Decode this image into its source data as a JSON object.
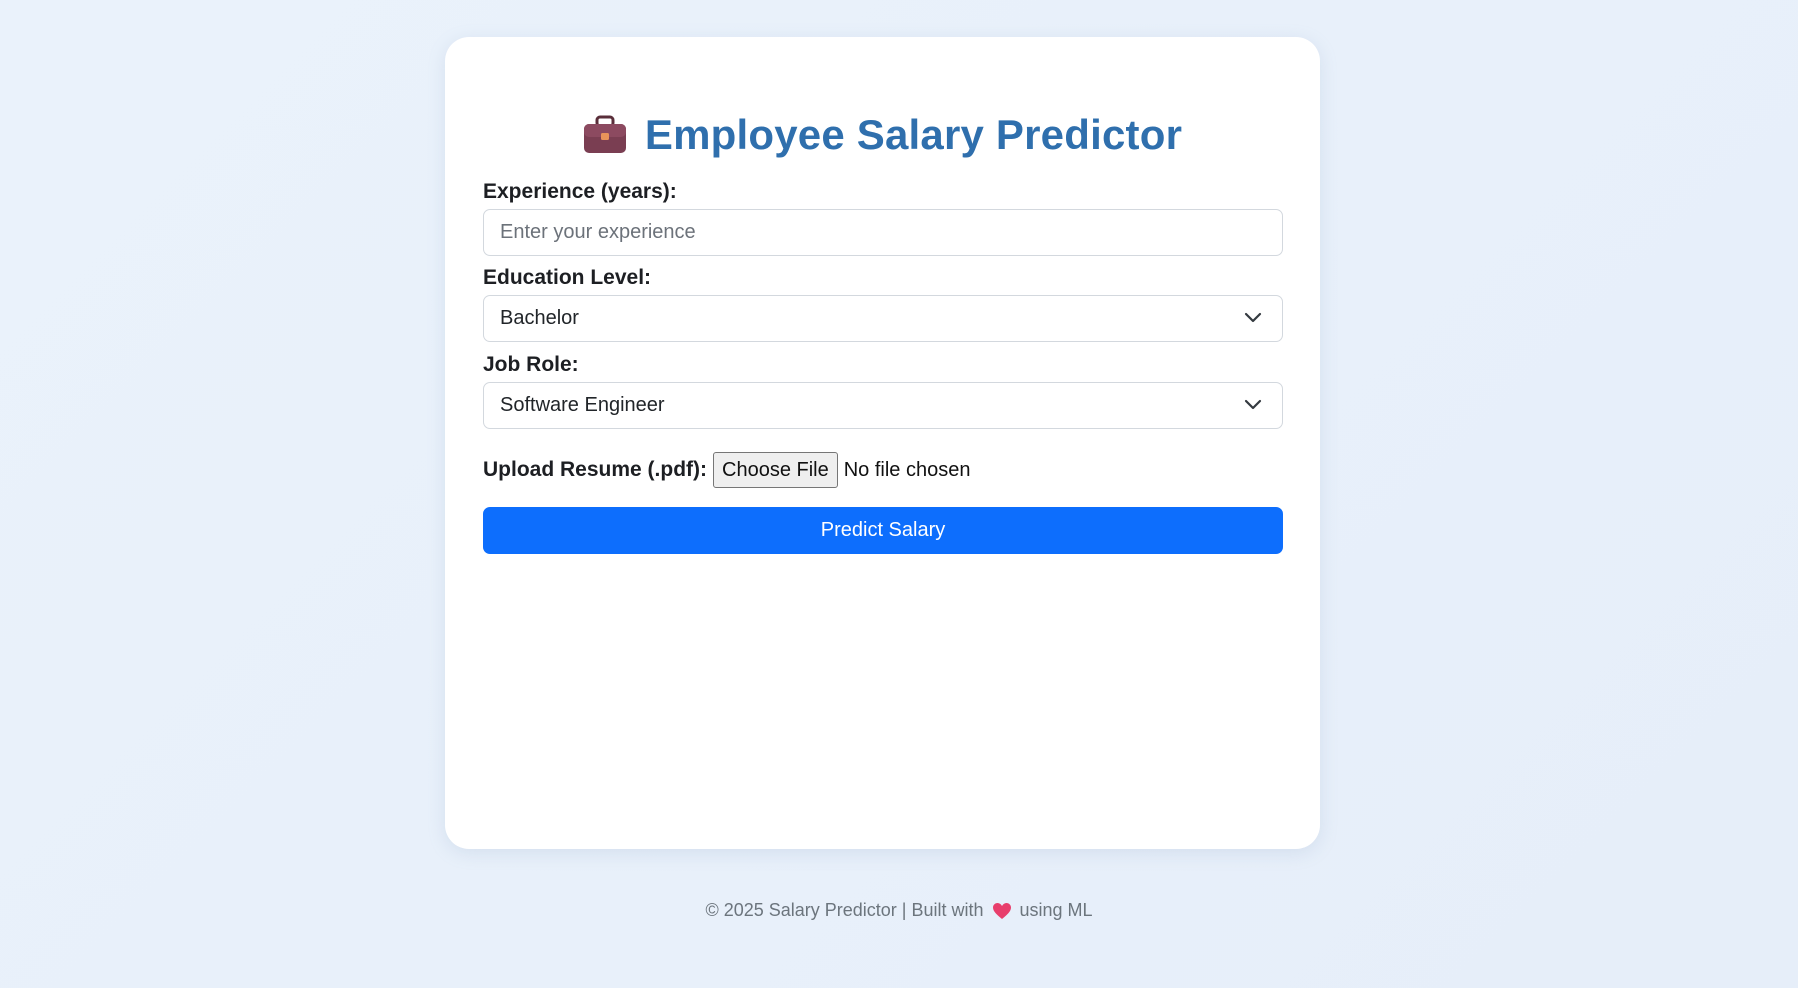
{
  "header": {
    "icon": "briefcase-icon",
    "title": "Employee Salary Predictor"
  },
  "form": {
    "experience": {
      "label": "Experience (years):",
      "value": "",
      "placeholder": "Enter your experience"
    },
    "education": {
      "label": "Education Level:",
      "selected": "Bachelor"
    },
    "job_role": {
      "label": "Job Role:",
      "selected": "Software Engineer"
    },
    "resume": {
      "label": "Upload Resume (.pdf):",
      "button_label": "Choose File",
      "status": "No file chosen"
    },
    "submit_label": "Predict Salary"
  },
  "footer": {
    "text_before": "© 2025 Salary Predictor | Built with",
    "icon": "heart-icon",
    "text_after": "using ML"
  },
  "colors": {
    "title": "#2f6fad",
    "primary_button": "#0d6efd",
    "background": "#eaf2fb"
  }
}
